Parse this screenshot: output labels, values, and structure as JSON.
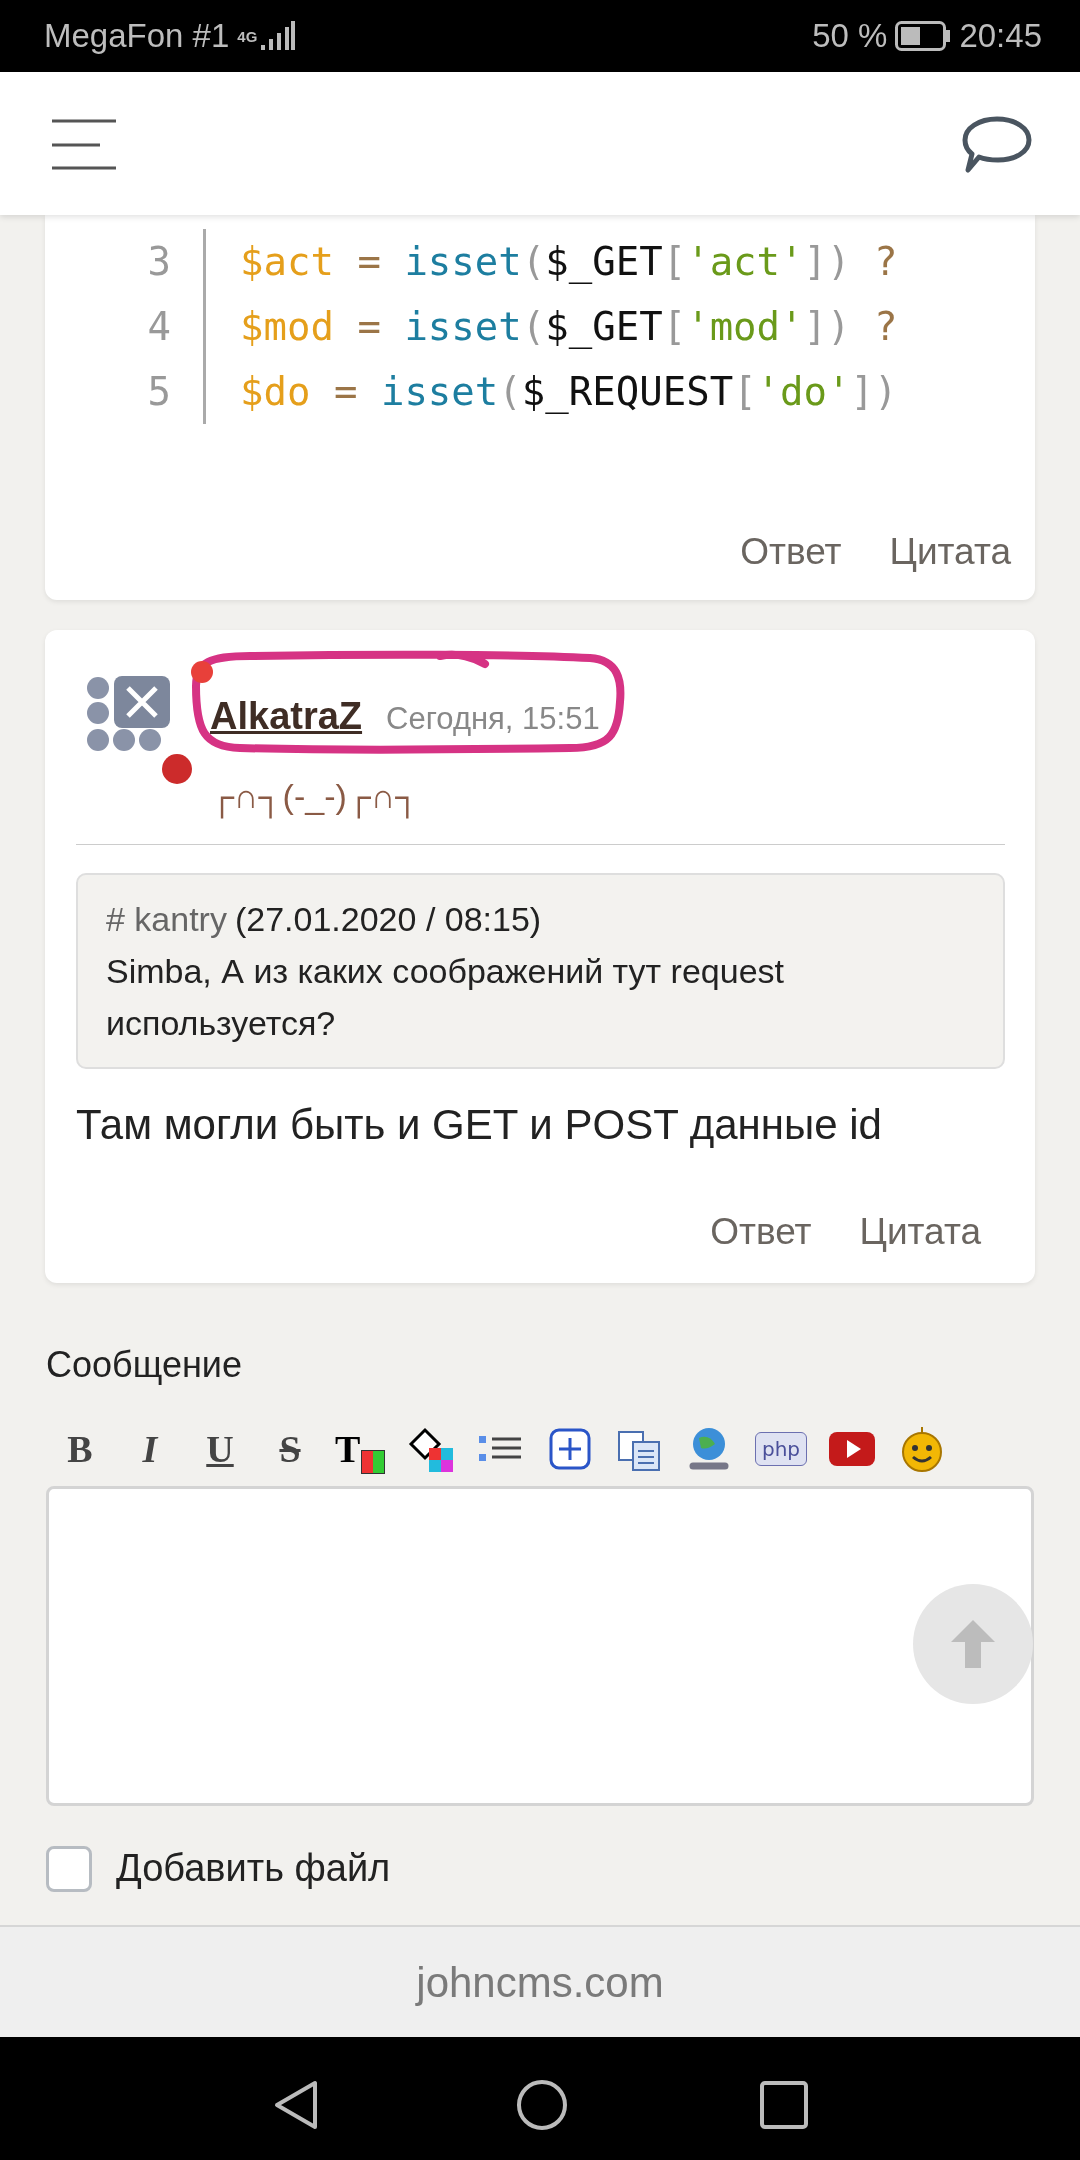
{
  "status_bar": {
    "carrier": "MegaFon #1",
    "network": "4G",
    "battery": "50 %",
    "time": "20:45"
  },
  "code_block": {
    "lines": [
      {
        "number": "3",
        "tokens": [
          {
            "kind": "var",
            "text": "$act"
          },
          {
            "kind": "op",
            "text": " = "
          },
          {
            "kind": "func",
            "text": "isset"
          },
          {
            "kind": "punct",
            "text": "("
          },
          {
            "kind": "plain",
            "text": "$_GET"
          },
          {
            "kind": "punct",
            "text": "["
          },
          {
            "kind": "str",
            "text": "'act'"
          },
          {
            "kind": "punct",
            "text": "])"
          },
          {
            "kind": "op",
            "text": " ?"
          }
        ]
      },
      {
        "number": "4",
        "tokens": [
          {
            "kind": "var",
            "text": "$mod"
          },
          {
            "kind": "op",
            "text": " = "
          },
          {
            "kind": "func",
            "text": "isset"
          },
          {
            "kind": "punct",
            "text": "("
          },
          {
            "kind": "plain",
            "text": "$_GET"
          },
          {
            "kind": "punct",
            "text": "["
          },
          {
            "kind": "str",
            "text": "'mod'"
          },
          {
            "kind": "punct",
            "text": "])"
          },
          {
            "kind": "op",
            "text": " ?"
          }
        ]
      },
      {
        "number": "5",
        "tokens": [
          {
            "kind": "var",
            "text": "$do"
          },
          {
            "kind": "op",
            "text": " = "
          },
          {
            "kind": "func",
            "text": "isset"
          },
          {
            "kind": "punct",
            "text": "("
          },
          {
            "kind": "plain",
            "text": "$_REQUEST"
          },
          {
            "kind": "punct",
            "text": "["
          },
          {
            "kind": "str",
            "text": "'do'"
          },
          {
            "kind": "punct",
            "text": "])"
          }
        ]
      }
    ],
    "actions": [
      "Ответ",
      "Цитата"
    ]
  },
  "post": {
    "author": "AlkatraZ",
    "online": false,
    "date": "Сегодня, 15:51",
    "user_status": "┌∩┐(-_-)┌∩┐",
    "quote": {
      "author": "# kantry",
      "date": "(27.01.2020 / 08:15)",
      "text": "Simba, А из каких соображений тут request используется?"
    },
    "text": "Там могли быть и GET и POST данные id",
    "actions": [
      "Ответ",
      "Цитата"
    ]
  },
  "message_form": {
    "label": "Сообщение",
    "toolbar": [
      {
        "kind": "bold",
        "label": "B"
      },
      {
        "kind": "italic",
        "label": "I"
      },
      {
        "kind": "underline",
        "label": "U"
      },
      {
        "kind": "strike",
        "label": "S"
      },
      {
        "kind": "text-color",
        "label": "T"
      },
      {
        "kind": "bg-color"
      },
      {
        "kind": "list"
      },
      {
        "kind": "spoiler"
      },
      {
        "kind": "copy"
      },
      {
        "kind": "link"
      },
      {
        "kind": "php",
        "label": "php"
      },
      {
        "kind": "video"
      },
      {
        "kind": "smiley"
      }
    ],
    "attach_label": "Добавить файл",
    "attach_checked": false
  },
  "footer": {
    "domain": "johncms.com"
  }
}
